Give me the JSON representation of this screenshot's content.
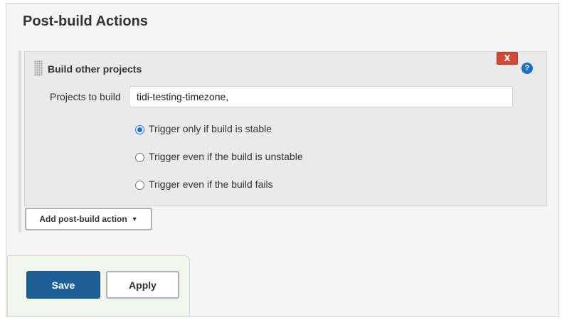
{
  "section": {
    "title": "Post-build Actions"
  },
  "step": {
    "title": "Build other projects",
    "delete_label": "X",
    "help_label": "?",
    "projects_label": "Projects to build",
    "projects_value": "tidi-testing-timezone,",
    "trigger_options": [
      {
        "label": "Trigger only if build is stable",
        "checked": true
      },
      {
        "label": "Trigger even if the build is unstable",
        "checked": false
      },
      {
        "label": "Trigger even if the build fails",
        "checked": false
      }
    ]
  },
  "add_action": {
    "label": "Add post-build action",
    "caret": "▼"
  },
  "footer": {
    "save_label": "Save",
    "apply_label": "Apply"
  },
  "colors": {
    "save_bg": "#1f5f97",
    "delete_bg": "#d24939",
    "help_bg": "#1a70c4",
    "footer_bg": "#f1f6ec"
  }
}
